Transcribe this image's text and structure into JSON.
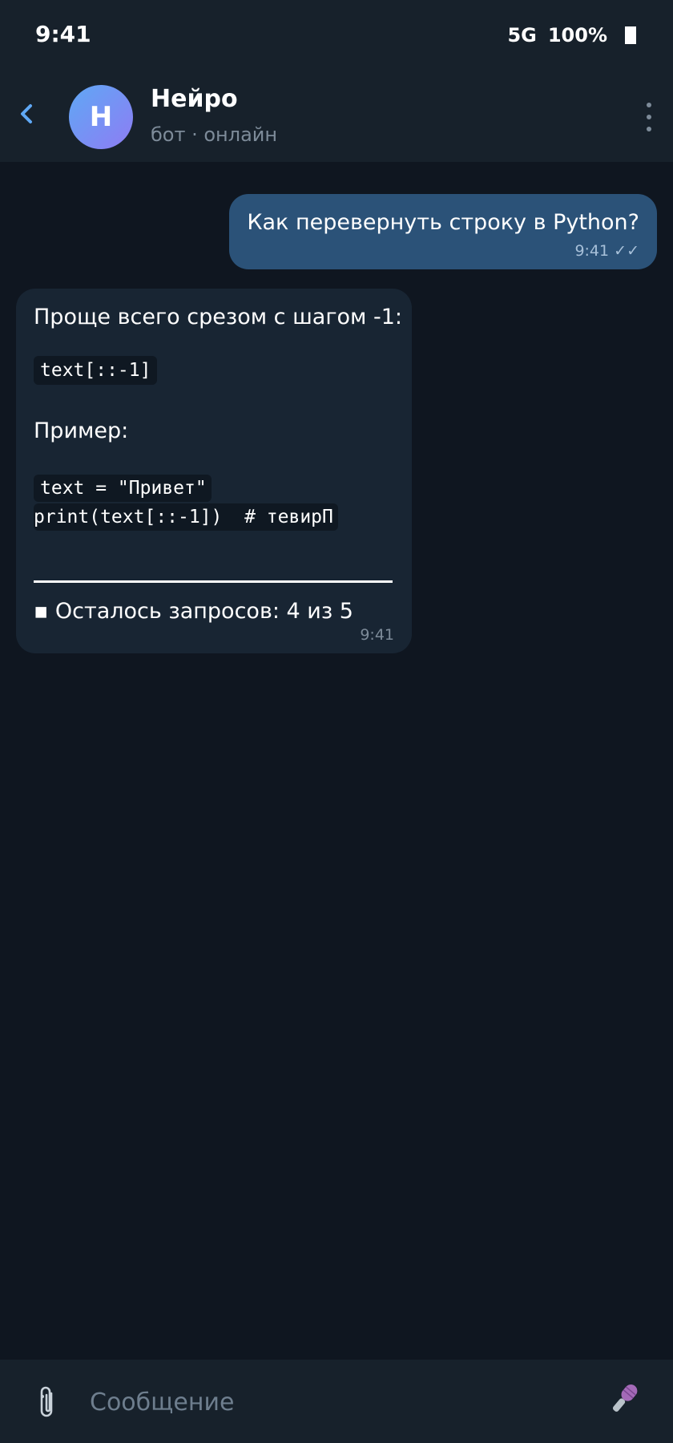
{
  "status_bar": {
    "time": "9:41",
    "network": "5G",
    "battery": "100%"
  },
  "header": {
    "avatar_letter": "Н",
    "name": "Нейро",
    "status": "бот · онлайн",
    "avatar_gradient": [
      "#5fa8f5",
      "#8e7cf3"
    ]
  },
  "messages": {
    "outgoing": {
      "text": "Как перевернуть строку в Python?",
      "time": "9:41",
      "checks": "✓✓"
    },
    "incoming": {
      "intro": "Проще всего срезом с шагом -1:",
      "code_inline": "text[::-1]",
      "example_label": "Пример:",
      "code_lines": [
        "text = \"Привет\"",
        "print(text[::-1])  # тевирП"
      ],
      "quota_text": "▪ Осталось запросов: 4 из 5",
      "time": "9:41"
    }
  },
  "input": {
    "placeholder": "Сообщение"
  },
  "colors": {
    "background": "#0f1620",
    "bar": "#17212b",
    "outgoing_bubble": "#2b5278",
    "incoming_bubble": "#182533",
    "accent": "#5fa8f5"
  },
  "icons": {
    "back": "chevron-left-icon",
    "menu": "more-vertical-icon",
    "attach": "paperclip-icon",
    "mic": "microphone-icon"
  }
}
